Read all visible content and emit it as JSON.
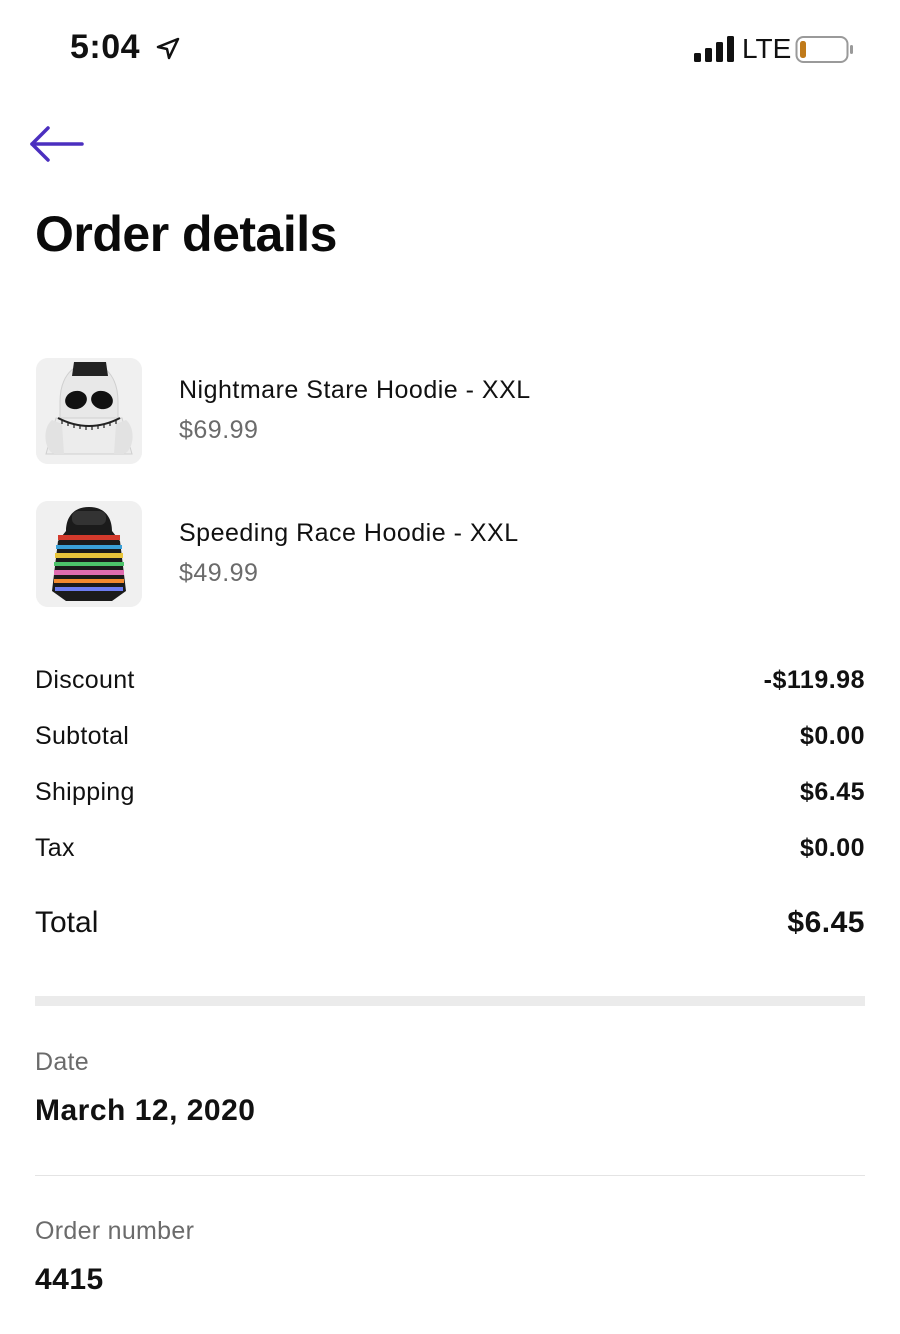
{
  "status_bar": {
    "time": "5:04",
    "network": "LTE",
    "icons": [
      "location-arrow-icon",
      "signal-bars-icon",
      "battery-low-icon"
    ],
    "battery_fill_fraction": 0.1,
    "battery_color": "#c07a1a"
  },
  "header": {
    "back_icon": "arrow-left-icon",
    "back_color": "#4b2fbf",
    "title": "Order details"
  },
  "items": [
    {
      "name": "Nightmare Stare Hoodie - XXL",
      "price": "$69.99",
      "image_icon": "skull-hoodie-image"
    },
    {
      "name": "Speeding Race Hoodie - XXL",
      "price": "$49.99",
      "image_icon": "racing-hoodie-image"
    }
  ],
  "summary": {
    "discount": {
      "label": "Discount",
      "value": "-$119.98"
    },
    "subtotal": {
      "label": "Subtotal",
      "value": "$0.00"
    },
    "shipping": {
      "label": "Shipping",
      "value": "$6.45"
    },
    "tax": {
      "label": "Tax",
      "value": "$0.00"
    },
    "total": {
      "label": "Total",
      "value": "$6.45"
    }
  },
  "details": {
    "date": {
      "label": "Date",
      "value": "March 12, 2020"
    },
    "order_number": {
      "label": "Order number",
      "value": "4415"
    }
  }
}
